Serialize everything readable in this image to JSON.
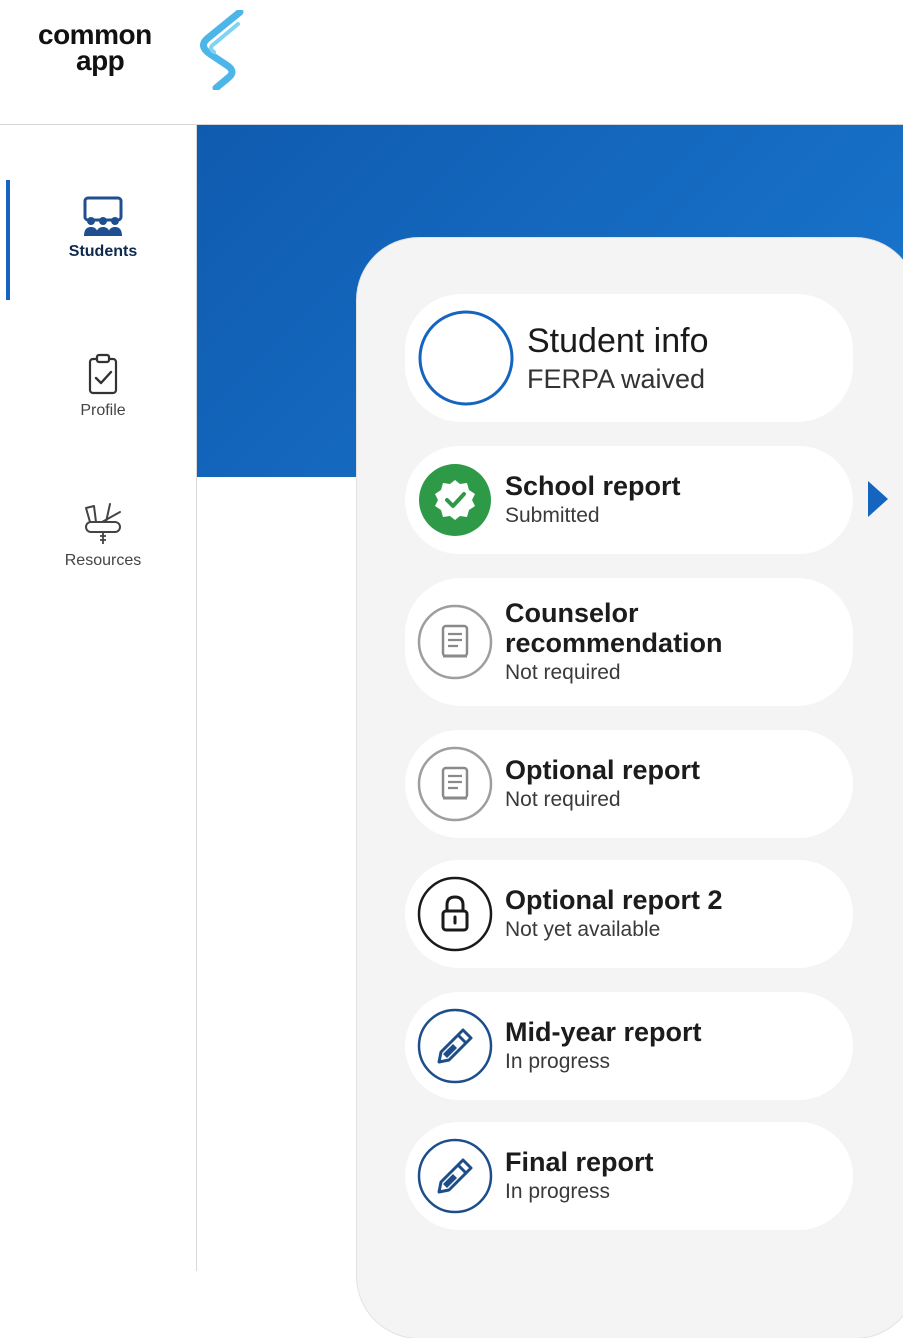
{
  "brand": {
    "line1": "common",
    "line2": "app"
  },
  "sidebar": {
    "items": [
      {
        "label": "Students",
        "icon": "students-icon",
        "active": true
      },
      {
        "label": "Profile",
        "icon": "clipboard-check-icon",
        "active": false
      },
      {
        "label": "Resources",
        "icon": "swiss-knife-icon",
        "active": false
      }
    ]
  },
  "student": {
    "title": "Student info",
    "status": "FERPA waived"
  },
  "reports": [
    {
      "title": "School report",
      "status": "Submitted",
      "icon": "submitted-check-icon"
    },
    {
      "title_line1": "Counselor",
      "title_line2": "recommendation",
      "status": "Not required",
      "icon": "document-icon"
    },
    {
      "title": "Optional report",
      "status": "Not required",
      "icon": "document-icon"
    },
    {
      "title": "Optional report 2",
      "status": "Not yet available",
      "icon": "lock-icon"
    },
    {
      "title": "Mid-year report",
      "status": "In progress",
      "icon": "pencil-icon"
    },
    {
      "title": "Final report",
      "status": "In progress",
      "icon": "pencil-icon"
    }
  ],
  "colors": {
    "accent": "#1565c0",
    "banner": "#1168c0",
    "success": "#2e9a48",
    "muted": "#9e9e9e",
    "navy": "#1d4e89"
  }
}
